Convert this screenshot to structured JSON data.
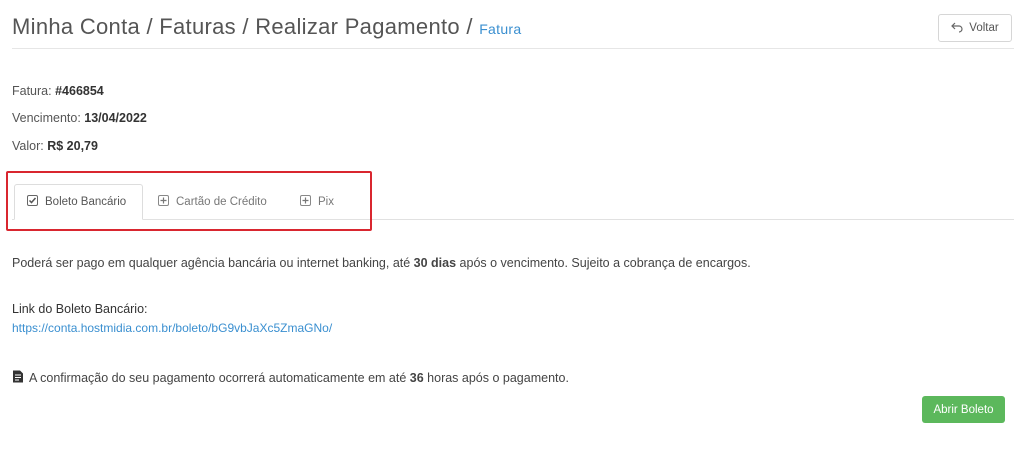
{
  "header": {
    "breadcrumb_main": "Minha Conta / Faturas / Realizar Pagamento /",
    "breadcrumb_current": "Fatura",
    "back_label": "Voltar"
  },
  "invoice": {
    "number_label": "Fatura:",
    "number_value": "#466854",
    "due_label": "Vencimento:",
    "due_value": "13/04/2022",
    "amount_label": "Valor:",
    "amount_value": "R$ 20,79"
  },
  "tabs": [
    {
      "label": "Boleto Bancário",
      "icon": "checkbox-checked-icon",
      "active": true
    },
    {
      "label": "Cartão de Crédito",
      "icon": "plus-square-icon",
      "active": false
    },
    {
      "label": "Pix",
      "icon": "plus-square-icon",
      "active": false
    }
  ],
  "content": {
    "description_pre": "Poderá ser pago em qualquer agência bancária ou internet banking, até ",
    "description_bold": "30 dias",
    "description_post": " após o vencimento. Sujeito a cobrança de encargos.",
    "link_label": "Link do Boleto Bancário:",
    "link_url": "https://conta.hostmidia.com.br/boleto/bG9vbJaXc5ZmaGNo/",
    "note_icon": "document-icon",
    "note_pre": "A confirmação do seu pagamento ocorrerá automaticamente em até ",
    "note_bold": "36",
    "note_post": " horas após o pagamento.",
    "open_button": "Abrir Boleto"
  },
  "colors": {
    "link": "#3a8fd0",
    "highlight": "#d9262f",
    "button_green": "#5cb85c"
  }
}
